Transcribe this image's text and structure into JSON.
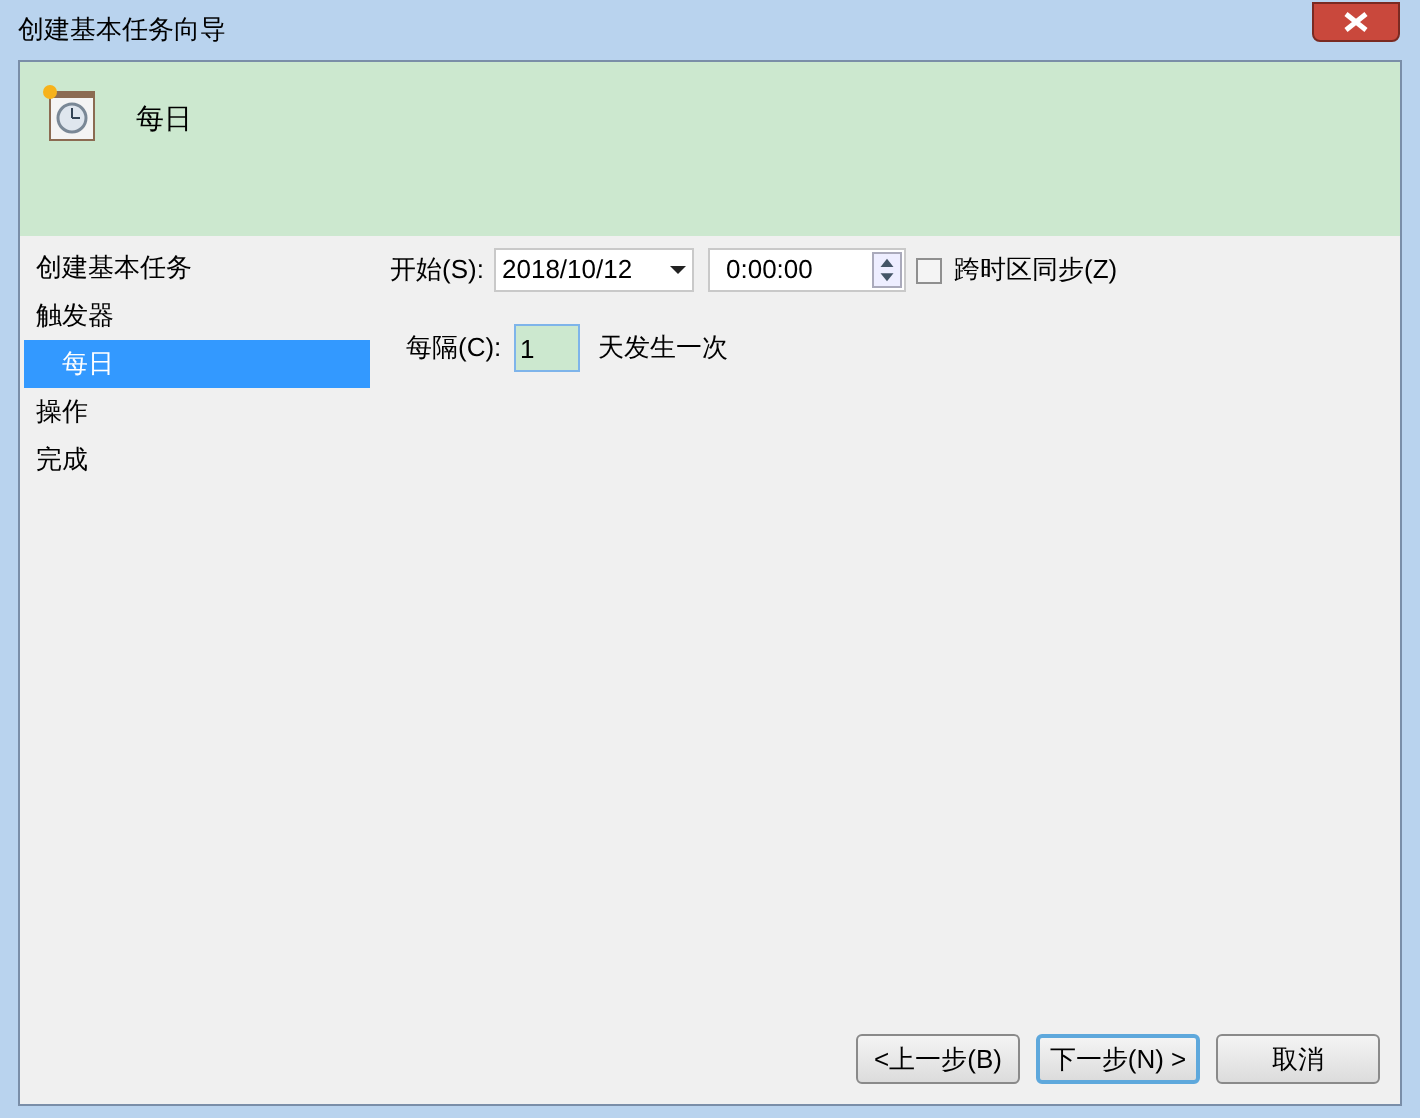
{
  "window": {
    "title": "创建基本任务向导"
  },
  "header": {
    "title": "每日"
  },
  "sidebar": {
    "items": [
      {
        "label": "创建基本任务",
        "selected": false
      },
      {
        "label": "触发器",
        "selected": false,
        "children": [
          {
            "label": "每日",
            "selected": true
          }
        ]
      },
      {
        "label": "操作",
        "selected": false
      },
      {
        "label": "完成",
        "selected": false
      }
    ]
  },
  "start": {
    "label": "开始(S):",
    "date": "2018/10/12",
    "time": "0:00:00",
    "sync_label": "跨时区同步(Z)",
    "sync_checked": false
  },
  "recur": {
    "label": "每隔(C):",
    "value": "1",
    "suffix": "天发生一次"
  },
  "buttons": [
    {
      "label": "<上一步(B)",
      "default": false
    },
    {
      "label": "下一步(N) >",
      "default": true
    },
    {
      "label": "取消",
      "default": false
    }
  ]
}
